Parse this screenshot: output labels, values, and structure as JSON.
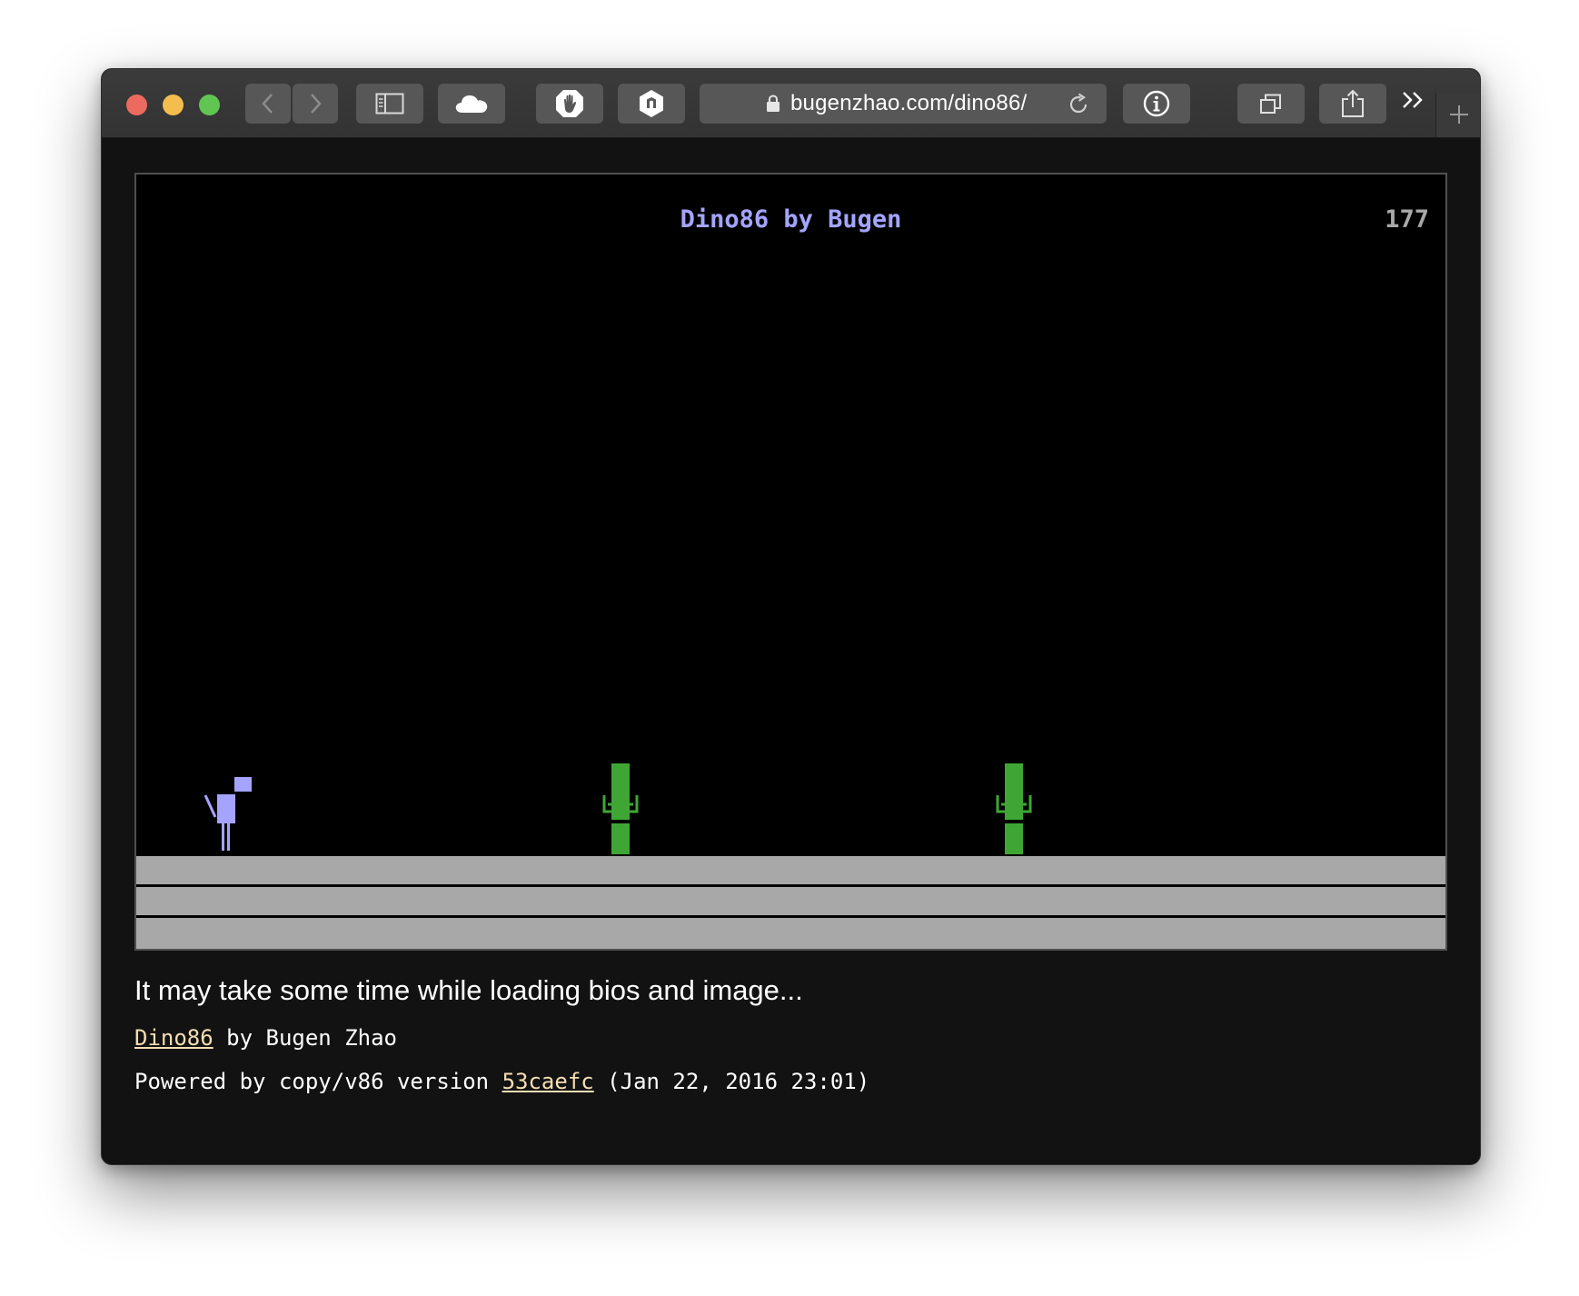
{
  "browser": {
    "url": "bugenzhao.com/dino86/",
    "icons": [
      "back-icon",
      "forward-icon",
      "sidebar-icon",
      "cloud-icon",
      "hand-stop-icon",
      "extension-icon",
      "lock-icon",
      "reload-icon",
      "info-icon",
      "tabs-icon",
      "share-icon",
      "more-chevrons-icon",
      "new-tab-icon"
    ]
  },
  "game": {
    "title": "Dino86 by Bugen",
    "score": "177",
    "colors": {
      "title": "#a4a4ff",
      "dino": "#a4a4ff",
      "cactus": "#3fa635",
      "ground": "#a8a8a8",
      "score": "#a8a8a8"
    }
  },
  "footer": {
    "loading_text": "It may take some time while loading bios and image...",
    "credit_link": "Dino86",
    "credit_rest": " by Bugen Zhao",
    "powered_prefix": "Powered by copy/v86 version ",
    "version_link": "53caefc",
    "powered_suffix": " (Jan 22, 2016 23:01)",
    "link_color": "#f5deb3"
  }
}
